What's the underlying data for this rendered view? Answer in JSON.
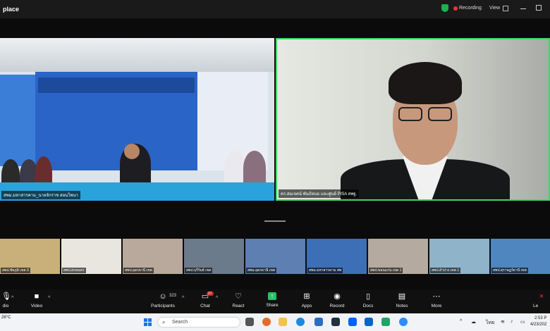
{
  "window": {
    "title": "place"
  },
  "header": {
    "recording_label": "Recording",
    "view_label": "View"
  },
  "videos": {
    "left_name": "สพม.มหาสารคาม_นายจักราช สอนโพนา",
    "right_name": "ดร.สมเจตน์ พันธ์หนอ และศูนย์ PISA สพฐ."
  },
  "thumbnails": [
    "สพป.ชัยภูมิ เขต 3",
    "สพป.สกลนคร",
    "สพป.อุดรธานี เขต",
    "สพป.บุรีรัมย์ เขต",
    "สพม.อุดรธานี เขต",
    "สพม.มหาสารคาม สพ",
    "สพป.ขอนแก่น เขต 1",
    "สพป.ลำปาง เขต 1",
    "สพป.สุราษฎร์ธานี เขต"
  ],
  "controls": {
    "audio": "dio",
    "video": "Video",
    "participants": "Participants",
    "participants_count": "323",
    "chat": "Chat",
    "chat_badge": "27",
    "react": "React",
    "share": "Share",
    "apps": "Apps",
    "record": "Record",
    "docs": "Docs",
    "notes": "Notes",
    "more": "More",
    "leave": "Le"
  },
  "taskbar": {
    "temperature": "28°C",
    "search_placeholder": "Search",
    "language": "ไทย",
    "time": "2:53 P",
    "date": "4/23/202"
  },
  "colors": {
    "active_speaker_border": "#3fd76a",
    "recording": "#e33333",
    "share": "#27c265",
    "chat_badge": "#e02424"
  }
}
